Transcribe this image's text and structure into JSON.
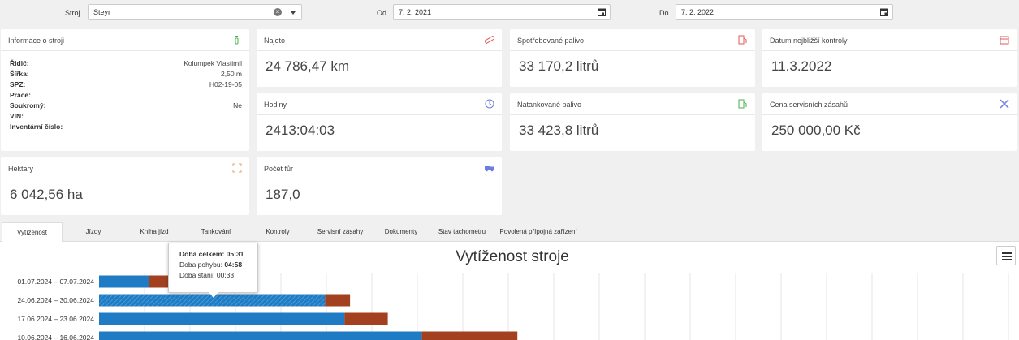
{
  "filters": {
    "machine_label": "Stroj",
    "machine_value": "Steyr",
    "from_label": "Od",
    "from_value": "7. 2. 2021",
    "to_label": "Do",
    "to_value": "7. 2. 2022"
  },
  "info_card": {
    "title": "Informace o stroji",
    "rows": [
      {
        "k": "Řidič:",
        "v": "Kolumpek Vlastimil"
      },
      {
        "k": "Šířka:",
        "v": "2,50 m"
      },
      {
        "k": "SPZ:",
        "v": "H02-19-05"
      },
      {
        "k": "Práce:",
        "v": ""
      },
      {
        "k": "Soukromý:",
        "v": "Ne"
      },
      {
        "k": "VIN:",
        "v": ""
      },
      {
        "k": "Inventární číslo:",
        "v": ""
      }
    ]
  },
  "cards": {
    "najeto": {
      "title": "Najeto",
      "value": "24 786,47 km"
    },
    "spotreba": {
      "title": "Spotřebované palivo",
      "value": "33 170,2 litrů"
    },
    "kontrola": {
      "title": "Datum nejbližší kontroly",
      "value": "11.3.2022"
    },
    "hodiny": {
      "title": "Hodiny",
      "value": "2413:04:03"
    },
    "natankovane": {
      "title": "Natankované palivo",
      "value": "33 423,8 litrů"
    },
    "servis": {
      "title": "Cena servisních zásahů",
      "value": "250 000,00 Kč"
    },
    "hektary": {
      "title": "Hektary",
      "value": "6 042,56 ha"
    },
    "fury": {
      "title": "Počet fůr",
      "value": "187,0"
    }
  },
  "icons": {
    "info": "info-icon",
    "najeto": "ruler-icon",
    "spotreba": "fuel-icon",
    "kontrola": "calendar-icon",
    "hodiny": "clock-icon",
    "natankovane": "fuel-icon",
    "servis": "tools-icon",
    "hektary": "area-icon",
    "fury": "truck-icon"
  },
  "tabs": [
    "Vytíženost",
    "Jízdy",
    "Kniha jízd",
    "Tankování",
    "Kontroly",
    "Servisní zásahy",
    "Dokumenty",
    "Stav tachometru",
    "Povolená přípojná zařízení"
  ],
  "active_tab": 0,
  "colors": {
    "movement": "#1f7cc4",
    "standing": "#a3401f",
    "blue_icon": "#6c7ce0",
    "orange_icon": "#f0a060",
    "green_icon": "#4caf50",
    "red_icon": "#e05a5a"
  },
  "chart_data": {
    "type": "bar",
    "orientation": "horizontal",
    "stacked": true,
    "title": "Vytíženost stroje",
    "categories": [
      "01.07.2024 – 07.07.2024",
      "24.06.2024 – 30.06.2024",
      "17.06.2024 – 23.06.2024",
      "10.06.2024 – 16.06.2024"
    ],
    "series": [
      {
        "values": [
          1.1,
          4.97,
          5.4,
          7.1
        ]
      },
      {
        "values": [
          1.6,
          0.55,
          0.95,
          2.1
        ]
      }
    ],
    "hovered_category": 1,
    "tooltip": {
      "total_label": "Doba celkem:",
      "total_value": "05:31",
      "movement_label": "Doba pohybu:",
      "movement_value": "04:58",
      "standing_label": "Doba stání:",
      "standing_value": "00:33"
    },
    "grid": true
  }
}
